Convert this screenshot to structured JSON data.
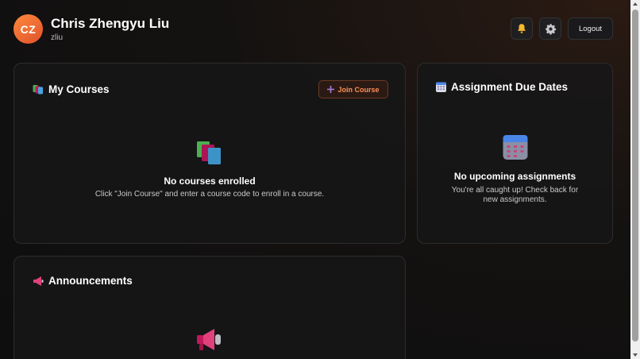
{
  "user": {
    "initials": "CZ",
    "name": "Chris Zhengyu Liu",
    "handle": "zliu"
  },
  "header": {
    "notifications_icon": "bell-icon",
    "settings_icon": "gear-icon",
    "logout_label": "Logout"
  },
  "courses": {
    "title": "My Courses",
    "title_icon": "books-icon",
    "join_label": "Join Course",
    "empty_title": "No courses enrolled",
    "empty_desc": "Click \"Join Course\" and enter a course code to enroll in a course."
  },
  "dues": {
    "title": "Assignment Due Dates",
    "title_icon": "calendar-icon",
    "empty_title": "No upcoming assignments",
    "empty_desc": "You're all caught up! Check back for new assignments."
  },
  "announcements": {
    "title": "Announcements",
    "title_icon": "megaphone-icon"
  },
  "colors": {
    "accent": "#f26b30",
    "background": "#121212",
    "card": "#161618"
  }
}
